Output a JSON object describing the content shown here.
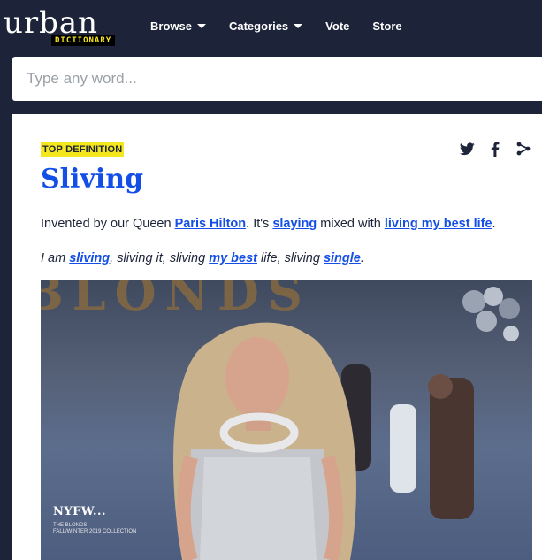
{
  "header": {
    "logo": {
      "word": "urban",
      "tag": "DICTIONARY"
    },
    "nav": [
      {
        "label": "Browse",
        "dropdown": true
      },
      {
        "label": "Categories",
        "dropdown": true
      },
      {
        "label": "Vote",
        "dropdown": false
      },
      {
        "label": "Store",
        "dropdown": false
      }
    ]
  },
  "search": {
    "placeholder": "Type any word..."
  },
  "definition": {
    "badge": "TOP DEFINITION",
    "word": "Sliving",
    "share_icons": [
      "twitter-icon",
      "facebook-icon",
      "share-icon"
    ],
    "meaning": {
      "t1": "Invented by our Queen ",
      "l1": "Paris Hilton",
      "t2": ". It's ",
      "l2": "slaying",
      "t3": " mixed with ",
      "l3": "living my best life",
      "t4": "."
    },
    "example": {
      "t1": "I am ",
      "l1": "sliving",
      "t2": ", sliving it, sliving ",
      "l2": "my best",
      "t3": " life, sliving ",
      "l3": "single",
      "t4": "."
    },
    "gif": {
      "banner": "BLONDS",
      "watermark": "NYFW...",
      "caption_line1": "THE BLONDS",
      "caption_line2": "FALL/WINTER 2019 COLLECTION"
    }
  },
  "colors": {
    "navy": "#1d2439",
    "accent_yellow": "#f4e71d",
    "link_blue": "#134fe6"
  }
}
